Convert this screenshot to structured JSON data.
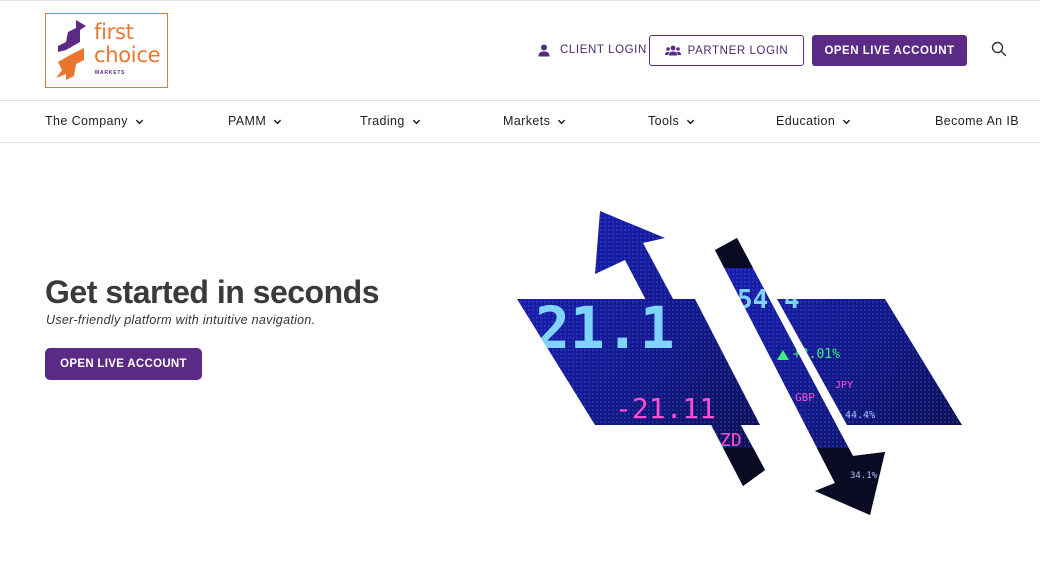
{
  "brand": {
    "name_line1": "first",
    "name_line2": "choice",
    "sub": "MARKETS",
    "accent_orange": "#e9762f",
    "accent_purple": "#5b2a84"
  },
  "header": {
    "client_login": "CLIENT LOGIN",
    "partner_login": "PARTNER LOGIN",
    "open_live_account": "OPEN LIVE ACCOUNT"
  },
  "nav": {
    "items": [
      {
        "label": "The Company",
        "has_dropdown": true
      },
      {
        "label": "PAMM",
        "has_dropdown": true
      },
      {
        "label": "Trading",
        "has_dropdown": true
      },
      {
        "label": "Markets",
        "has_dropdown": true
      },
      {
        "label": "Tools",
        "has_dropdown": true
      },
      {
        "label": "Education",
        "has_dropdown": true
      },
      {
        "label": "Become An IB",
        "has_dropdown": false
      }
    ]
  },
  "hero": {
    "title": "Get started in seconds",
    "subtitle": "User-friendly platform with intuitive navigation.",
    "cta": "OPEN LIVE ACCOUNT",
    "ticker": {
      "big_number": "21.1",
      "neg_value": "-21.11",
      "top_value": "54.4",
      "pos_change": "+3.01%",
      "currency_1": "GBP",
      "currency_2": "JPY",
      "small_1": "44.4%",
      "small_2": "34.1%",
      "fragment": "ZD"
    }
  }
}
